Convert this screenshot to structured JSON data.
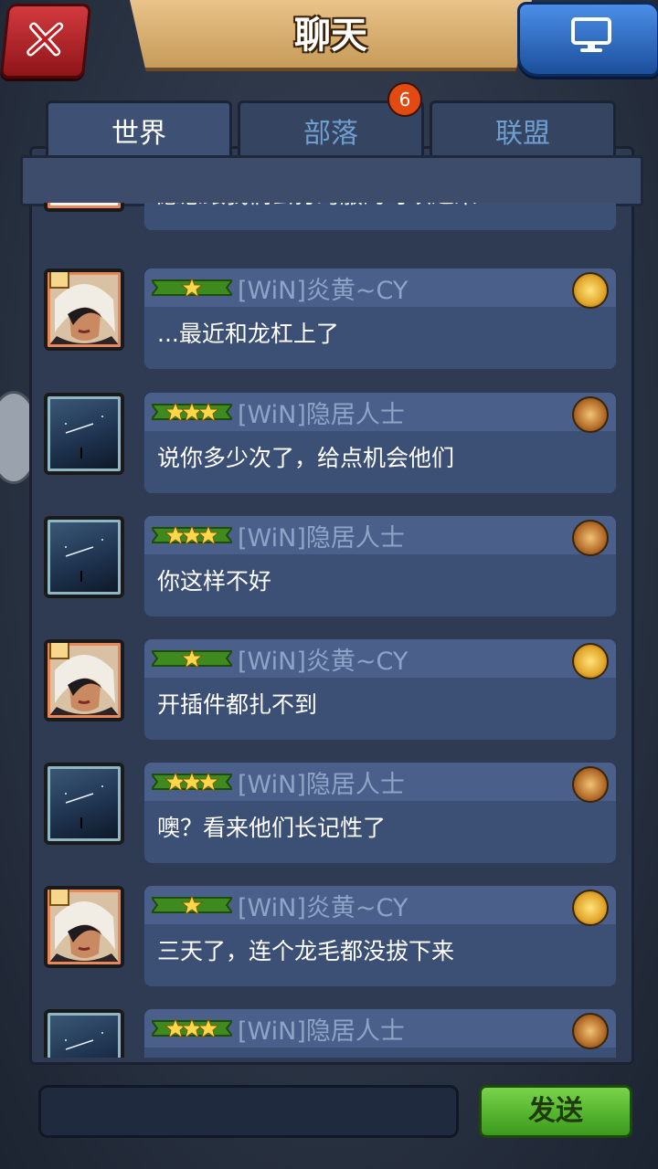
{
  "header": {
    "title": "聊天"
  },
  "tabs": [
    {
      "label": "世界",
      "active": true
    },
    {
      "label": "部落",
      "active": false
    },
    {
      "label": "联盟",
      "active": false
    }
  ],
  "tab_badge": "6",
  "messages": [
    {
      "avatar": "avatar-portrait-empty",
      "stars": 0,
      "name": "",
      "text": "愿意跟我们去打跨服的可以过来",
      "partial": true
    },
    {
      "avatar": "avatar-woman",
      "stars": 1,
      "name": "[WiN]炎黄~CY",
      "text": "...最近和龙杠上了",
      "rank": "gold-rank"
    },
    {
      "avatar": "avatar-night-sky",
      "stars": 3,
      "name": "[WiN]隐居人士",
      "text": "说你多少次了，给点机会他们",
      "rank": "brown-rank"
    },
    {
      "avatar": "avatar-night-sky",
      "stars": 3,
      "name": "[WiN]隐居人士",
      "text": "你这样不好",
      "rank": "brown-rank"
    },
    {
      "avatar": "avatar-woman",
      "stars": 1,
      "name": "[WiN]炎黄~CY",
      "text": "开插件都扎不到",
      "rank": "gold-rank"
    },
    {
      "avatar": "avatar-night-sky",
      "stars": 3,
      "name": "[WiN]隐居人士",
      "text": "噢？看来他们长记性了",
      "rank": "brown-rank"
    },
    {
      "avatar": "avatar-woman",
      "stars": 1,
      "name": "[WiN]炎黄~CY",
      "text": "三天了，连个龙毛都没拔下来",
      "rank": "gold-rank"
    },
    {
      "avatar": "avatar-night-sky",
      "stars": 3,
      "name": "[WiN]隐居人士",
      "text": "",
      "rank": "brown-rank",
      "partial": true
    }
  ],
  "composer": {
    "placeholder": "",
    "send_label": "发送"
  }
}
